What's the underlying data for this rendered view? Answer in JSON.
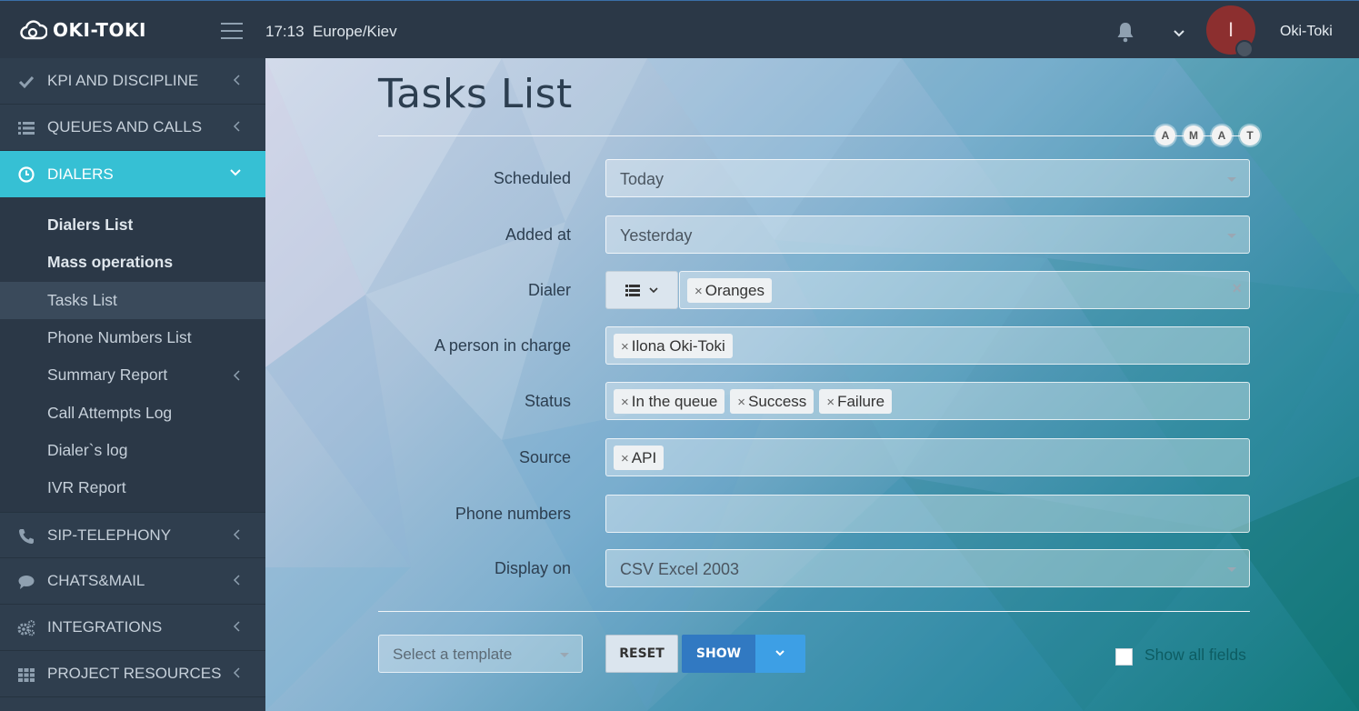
{
  "header": {
    "logo_text": "OKI-TOKI",
    "time": "17:13",
    "timezone": "Europe/Kiev",
    "avatar_letter": "I",
    "username": "Oki-Toki"
  },
  "sidebar": {
    "items_top": [
      {
        "label": "KPI AND DISCIPLINE",
        "icon": "check-icon"
      },
      {
        "label": "QUEUES AND CALLS",
        "icon": "list-icon"
      }
    ],
    "active": {
      "label": "DIALERS",
      "icon": "clock-icon"
    },
    "submenu": [
      {
        "label": "Dialers List"
      },
      {
        "label": "Mass operations"
      },
      {
        "label": "Tasks List"
      },
      {
        "label": "Phone Numbers List"
      },
      {
        "label": "Summary Report"
      },
      {
        "label": "Call Attempts Log"
      },
      {
        "label": "Dialer`s log"
      },
      {
        "label": "IVR Report"
      }
    ],
    "items_bottom": [
      {
        "label": "SIP-TELEPHONY",
        "icon": "phone-icon"
      },
      {
        "label": "CHATS&MAIL",
        "icon": "chat-icon"
      },
      {
        "label": "INTEGRATIONS",
        "icon": "gears-icon"
      },
      {
        "label": "PROJECT RESOURCES",
        "icon": "grid-icon"
      }
    ]
  },
  "page": {
    "title": "Tasks List",
    "badges": [
      "A",
      "M",
      "A",
      "T"
    ]
  },
  "form": {
    "scheduled": {
      "label": "Scheduled",
      "value": "Today"
    },
    "added_at": {
      "label": "Added at",
      "value": "Yesterday"
    },
    "dialer": {
      "label": "Dialer",
      "tags": [
        "Oranges"
      ]
    },
    "person": {
      "label": "A person in charge",
      "tags": [
        "Ilona Oki-Toki"
      ]
    },
    "status": {
      "label": "Status",
      "tags": [
        "In the queue",
        "Success",
        "Failure"
      ]
    },
    "source": {
      "label": "Source",
      "tags": [
        "API"
      ]
    },
    "phones": {
      "label": "Phone numbers",
      "value": ""
    },
    "display": {
      "label": "Display on",
      "value": "CSV Excel 2003"
    }
  },
  "footer": {
    "template_placeholder": "Select a template",
    "reset_label": "RESET",
    "show_label": "SHOW",
    "show_all_label": "Show all fields",
    "show_all_checked": false
  },
  "colors": {
    "accent": "#36c0d4",
    "primary_button": "#3179c2",
    "sidebar_bg": "#2f3e4e",
    "topbar_bg": "#2b3847"
  }
}
